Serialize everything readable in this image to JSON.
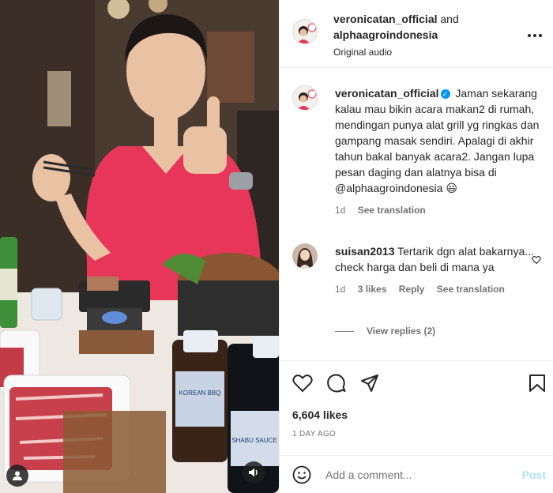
{
  "post": {
    "header": {
      "author": "veronicatan_official",
      "connector": "and",
      "collaborator": "alphaagroindonesia",
      "audio": "Original audio",
      "more_icon": "more-horizontal-icon"
    },
    "caption": {
      "username": "veronicatan_official",
      "text": "Jaman sekarang kalau mau bikin acara makan2 di rumah, mendingan punya alat grill yg ringkas dan gampang masak sendiri. Apalagi di akhir tahun bakal banyak acara2. Jangan lupa pesan daging dan alatnya bisa di @alphaagroindonesia 😃",
      "time": "1d",
      "see_translation": "See translation"
    },
    "comments": [
      {
        "username": "suisan2013",
        "text": "Tertarik dgn alat bakarnya... check harga dan beli di mana ya",
        "time": "1d",
        "likes": "3 likes",
        "reply": "Reply",
        "see_translation": "See translation",
        "view_replies": "View replies (2)"
      }
    ],
    "likes": "6,604 likes",
    "date": "1 DAY AGO",
    "add_comment": {
      "placeholder": "Add a comment...",
      "post_label": "Post"
    }
  },
  "media": {
    "bottle_label_1": "KOREAN BBQ",
    "bottle_label_2": "SHABU SAUCE"
  },
  "colors": {
    "verified": "#0095f6",
    "shirt": "#e8365a",
    "post_disabled": "#b2dffc"
  }
}
